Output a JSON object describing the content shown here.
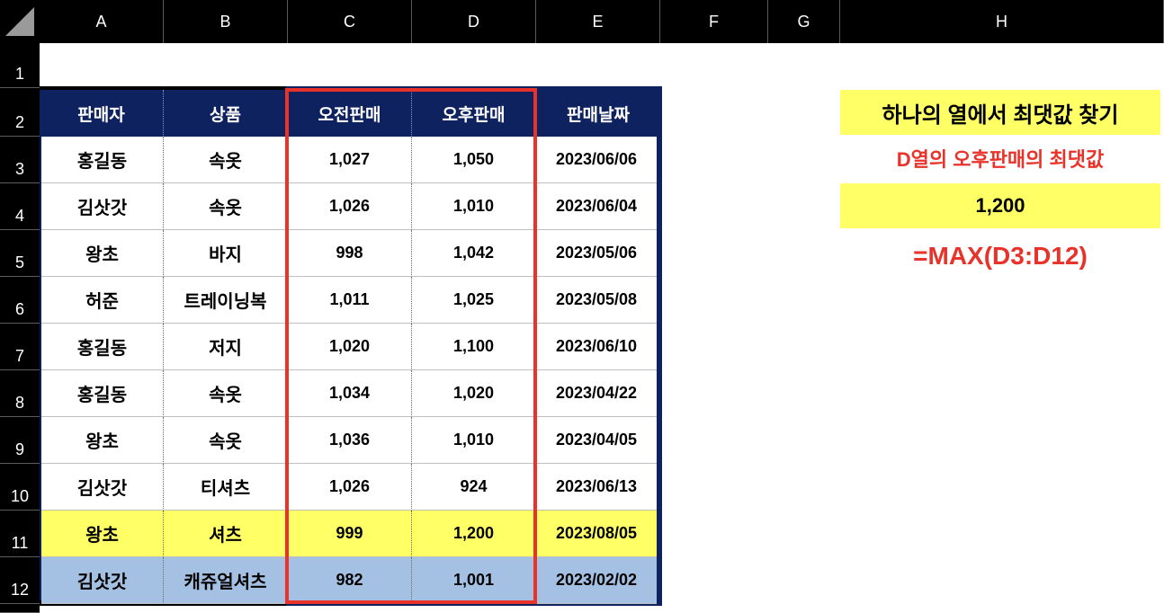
{
  "columns": [
    "A",
    "B",
    "C",
    "D",
    "E",
    "F",
    "G",
    "H"
  ],
  "rows": [
    "1",
    "2",
    "3",
    "4",
    "5",
    "6",
    "7",
    "8",
    "9",
    "10",
    "11",
    "12"
  ],
  "table": {
    "headers": [
      "판매자",
      "상품",
      "오전판매",
      "오후판매",
      "판매날짜"
    ],
    "data": [
      [
        "홍길동",
        "속옷",
        "1,027",
        "1,050",
        "2023/06/06"
      ],
      [
        "김삿갓",
        "속옷",
        "1,026",
        "1,010",
        "2023/06/04"
      ],
      [
        "왕초",
        "바지",
        "998",
        "1,042",
        "2023/05/06"
      ],
      [
        "허준",
        "트레이닝복",
        "1,011",
        "1,025",
        "2023/05/08"
      ],
      [
        "홍길동",
        "저지",
        "1,020",
        "1,100",
        "2023/06/10"
      ],
      [
        "홍길동",
        "속옷",
        "1,034",
        "1,020",
        "2023/04/22"
      ],
      [
        "왕초",
        "속옷",
        "1,036",
        "1,010",
        "2023/04/05"
      ],
      [
        "김삿갓",
        "티셔츠",
        "1,026",
        "924",
        "2023/06/13"
      ],
      [
        "왕초",
        "셔츠",
        "999",
        "1,200",
        "2023/08/05"
      ],
      [
        "김삿갓",
        "캐쥬얼셔츠",
        "982",
        "1,001",
        "2023/02/02"
      ]
    ]
  },
  "side": {
    "title": "하나의 열에서 최댓값 찾기",
    "subtitle": "D열의 오후판매의 최댓값",
    "result": "1,200",
    "formula": "=MAX(D3:D12)"
  },
  "colors": {
    "header_bg": "#0e2260",
    "highlight_yellow": "#ffff66",
    "highlight_blue": "#a4c1e3",
    "frame_red": "#e8322a"
  }
}
